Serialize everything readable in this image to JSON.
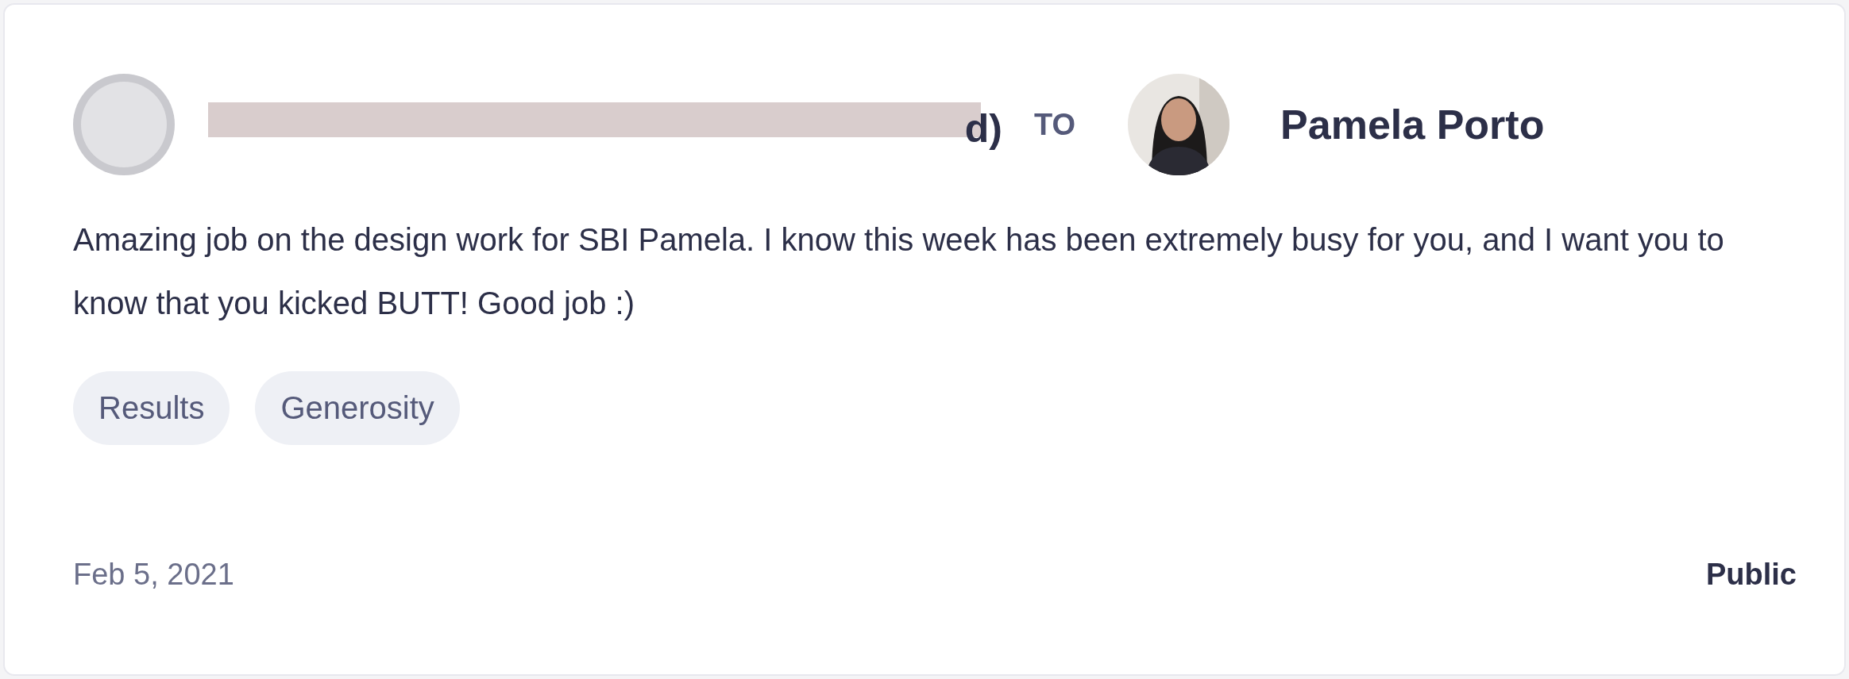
{
  "sender": {
    "name": "d)",
    "redacted": true
  },
  "connector": "TO",
  "recipient": {
    "name": "Pamela Porto"
  },
  "message": "Amazing job on the design work for SBI Pamela. I know this week has been extremely busy for you, and I want you to know that you kicked BUTT! Good job :)",
  "tags": [
    "Results",
    "Generosity"
  ],
  "date": "Feb 5, 2021",
  "visibility": "Public"
}
